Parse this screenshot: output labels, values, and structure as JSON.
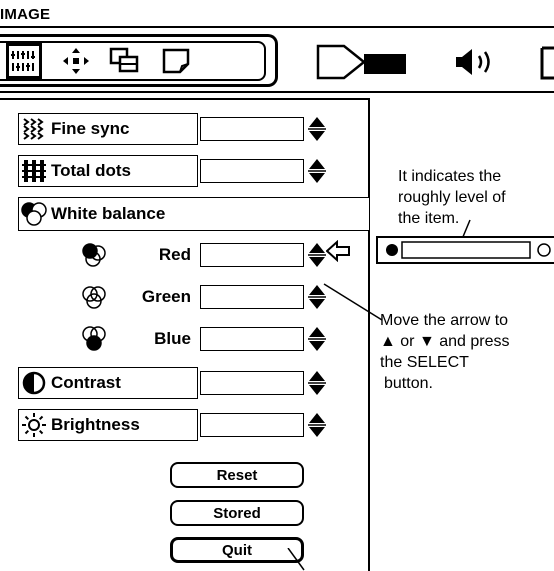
{
  "window": {
    "title": "IMAGE"
  },
  "menu_icons": [
    "image-adjust-icon",
    "position-icon",
    "pc-adjust-icon",
    "screen-icon",
    "projector-icon",
    "sound-icon",
    "setting-icon"
  ],
  "rows": [
    {
      "label": "Fine sync",
      "icon": "fine-sync-icon"
    },
    {
      "label": "Total dots",
      "icon": "total-dots-icon"
    },
    {
      "label": "White balance",
      "icon": "white-balance-icon"
    },
    {
      "label": "Red",
      "icon": "red-balance-icon"
    },
    {
      "label": "Green",
      "icon": "green-balance-icon"
    },
    {
      "label": "Blue",
      "icon": "blue-balance-icon"
    },
    {
      "label": "Contrast",
      "icon": "contrast-icon"
    },
    {
      "label": "Brightness",
      "icon": "brightness-icon"
    }
  ],
  "buttons": {
    "reset": "Reset",
    "stored": "Stored",
    "quit": "Quit"
  },
  "annotations": {
    "level_line1": "It indicates the",
    "level_line2": "roughly level of",
    "level_line3": "the item.",
    "arrow_line1": "Move the arrow to",
    "arrow_line2": "▲ or ▼ and press",
    "arrow_line3": "the SELECT",
    "arrow_line4": "button."
  }
}
